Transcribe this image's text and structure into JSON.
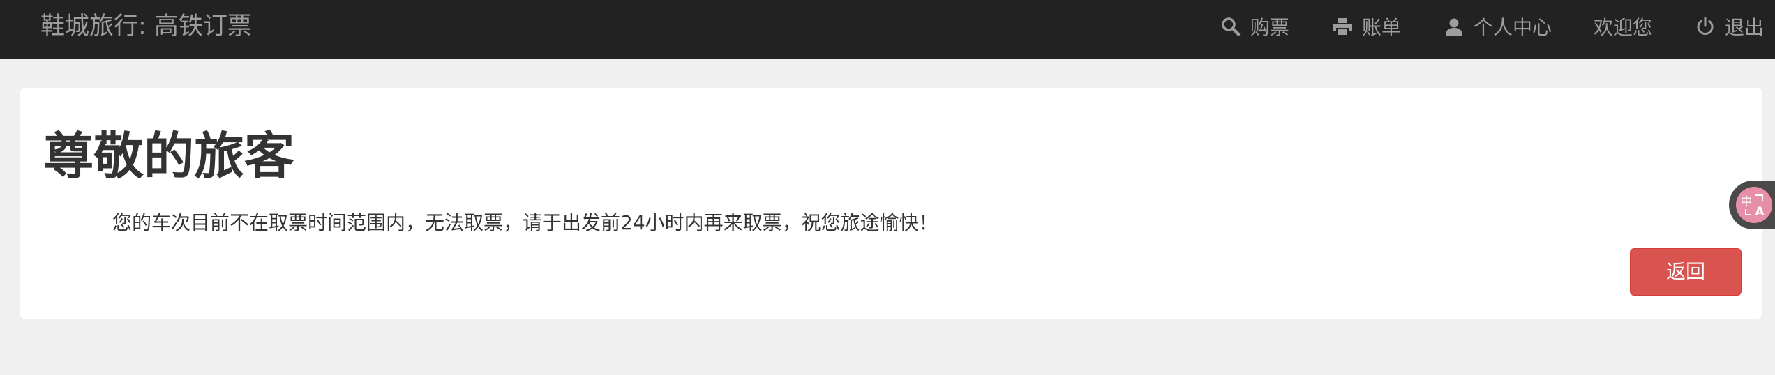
{
  "navbar": {
    "brand": "鞋城旅行: 高铁订票",
    "items": [
      {
        "label": "购票",
        "icon": "search-icon"
      },
      {
        "label": "账单",
        "icon": "printer-icon"
      },
      {
        "label": "个人中心",
        "icon": "user-icon"
      },
      {
        "label": "欢迎您"
      },
      {
        "label": "退出",
        "icon": "power-icon"
      }
    ]
  },
  "main": {
    "heading": "尊敬的旅客",
    "message": "您的车次目前不在取票时间范围内，无法取票，请于出发前24小时内再来取票，祝您旅途愉快！",
    "back_button": "返回"
  },
  "colors": {
    "navbar_bg": "#222222",
    "nav_text": "#9d9d9d",
    "page_bg": "#f0f0f0",
    "danger": "#d9534f",
    "translate_badge": "#e78fa8"
  }
}
